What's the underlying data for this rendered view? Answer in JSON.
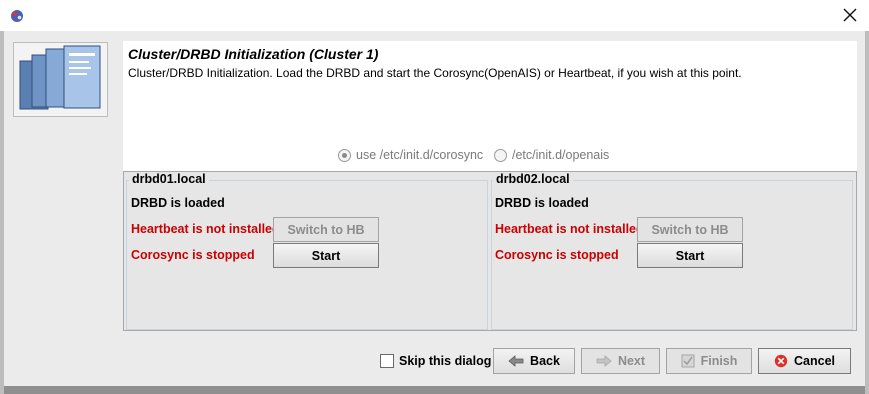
{
  "header": {
    "title": "Cluster/DRBD Initialization (Cluster 1)",
    "description": "Cluster/DRBD Initialization. Load the DRBD and start the Corosync(OpenAIS) or Heartbeat, if you wish at this point."
  },
  "init_options": [
    {
      "label": "use /etc/init.d/corosync",
      "selected": true
    },
    {
      "label": "/etc/init.d/openais",
      "selected": false
    }
  ],
  "hosts": [
    {
      "name": "drbd01.local",
      "drbd_status": "DRBD is loaded",
      "heartbeat_status": "Heartbeat is not installed",
      "corosync_status": "Corosync is stopped",
      "switch_label": "Switch to HB",
      "start_label": "Start"
    },
    {
      "name": "drbd02.local",
      "drbd_status": "DRBD is loaded",
      "heartbeat_status": "Heartbeat is not installed",
      "corosync_status": "Corosync is stopped",
      "switch_label": "Switch to HB",
      "start_label": "Start"
    }
  ],
  "footer": {
    "skip_label": "Skip this dialog",
    "skip_checked": false,
    "back_label": "Back",
    "next_label": "Next",
    "finish_label": "Finish",
    "cancel_label": "Cancel"
  },
  "colors": {
    "status_error": "#cc0000",
    "cancel_icon": "#d9342b"
  }
}
